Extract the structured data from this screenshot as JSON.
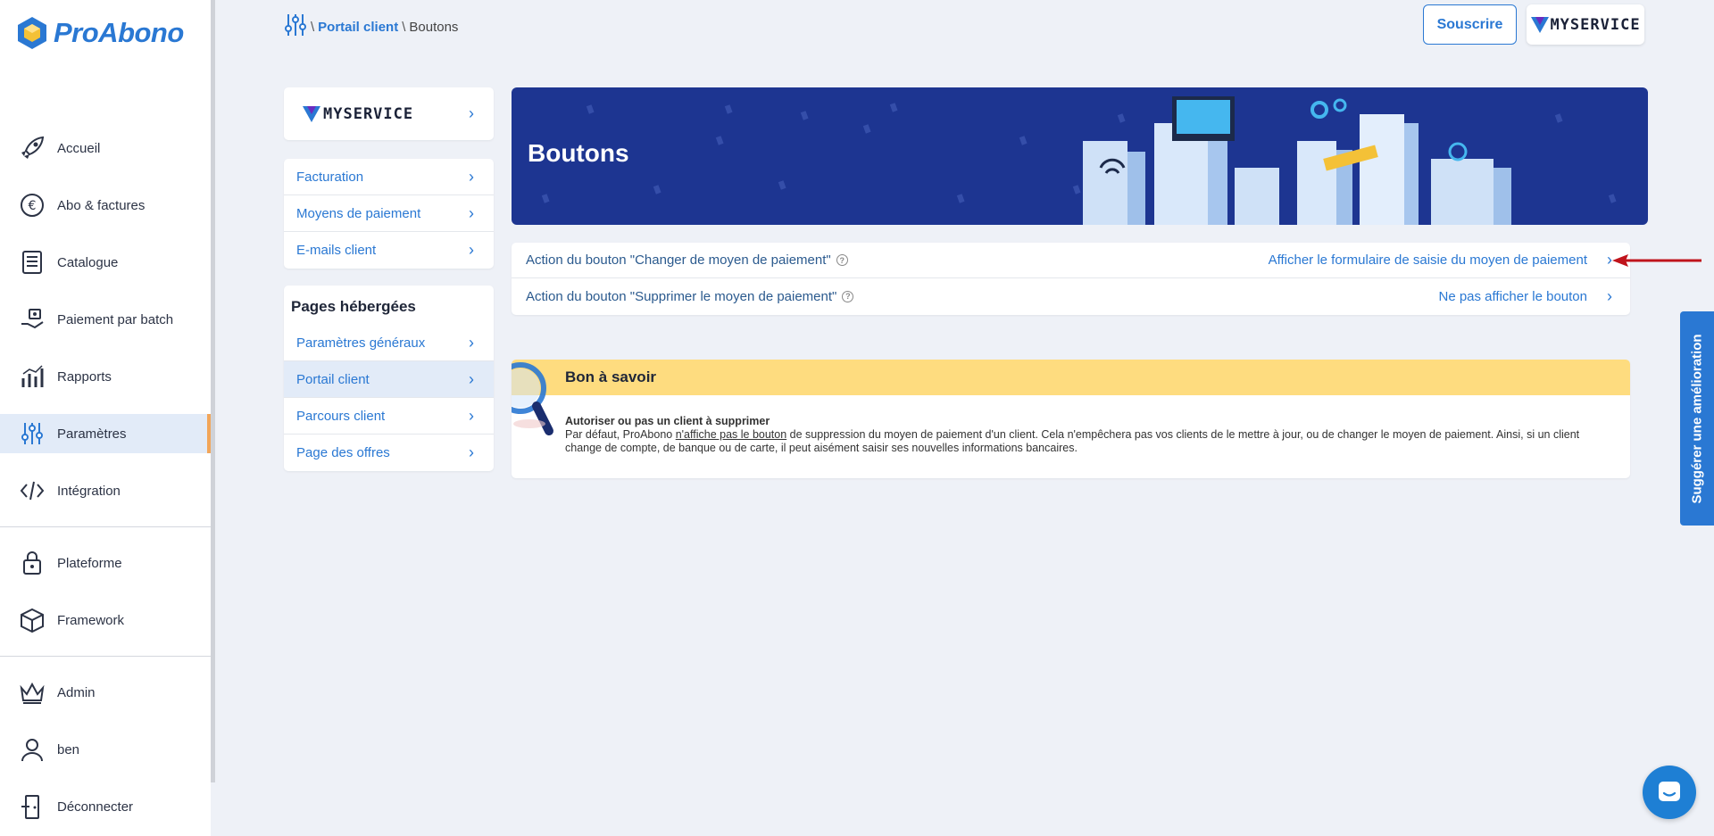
{
  "brand": {
    "name": "ProAbono",
    "accent": "#2a78d3",
    "highlight": "#f2a65a"
  },
  "sidebar": {
    "items": [
      {
        "label": "Accueil",
        "icon": "rocket-icon"
      },
      {
        "label": "Abo & factures",
        "icon": "euro-icon"
      },
      {
        "label": "Catalogue",
        "icon": "catalog-icon"
      },
      {
        "label": "Paiement par batch",
        "icon": "hand-money-icon"
      },
      {
        "label": "Rapports",
        "icon": "chart-icon"
      },
      {
        "label": "Paramètres",
        "icon": "sliders-icon",
        "active": true
      },
      {
        "label": "Intégration",
        "icon": "code-icon"
      },
      {
        "label": "Plateforme",
        "icon": "lock-icon"
      },
      {
        "label": "Framework",
        "icon": "box-icon"
      },
      {
        "label": "Admin",
        "icon": "crown-icon"
      },
      {
        "label": "ben",
        "icon": "user-icon"
      },
      {
        "label": "Déconnecter",
        "icon": "door-icon"
      }
    ]
  },
  "breadcrumb": {
    "link": "Portail client",
    "current": "Boutons",
    "sep": "\\"
  },
  "header": {
    "subscribe_label": "Souscrire",
    "service_brand": "MYSERVICE"
  },
  "submenu": {
    "service_name": "MYSERVICE",
    "group1": [
      "Facturation",
      "Moyens de paiement",
      "E-mails client"
    ],
    "hosted_title": "Pages hébergées",
    "group2": [
      "Paramètres généraux",
      "Portail client",
      "Parcours client",
      "Page des offres"
    ],
    "selected": "Portail client"
  },
  "banner": {
    "title": "Boutons"
  },
  "settings": [
    {
      "label": "Action du bouton \"Changer de moyen de paiement\"",
      "value": "Afficher le formulaire de saisie du moyen de paiement"
    },
    {
      "label": "Action du bouton \"Supprimer le moyen de paiement\"",
      "value": "Ne pas afficher le bouton"
    }
  ],
  "info": {
    "title": "Bon à savoir",
    "subtitle": "Autoriser ou pas un client à supprimer",
    "text_before": "Par défaut, ProAbono ",
    "text_link": "n'affiche pas le bouton",
    "text_after": " de suppression du moyen de paiement d'un client. Cela n'empêchera pas vos clients de le mettre à jour, ou de changer le moyen de paiement. Ainsi, si un client change de compte, de banque ou de carte, il peut aisément saisir ses nouvelles informations bancaires."
  },
  "suggest": {
    "label": "Suggérer une amélioration"
  }
}
